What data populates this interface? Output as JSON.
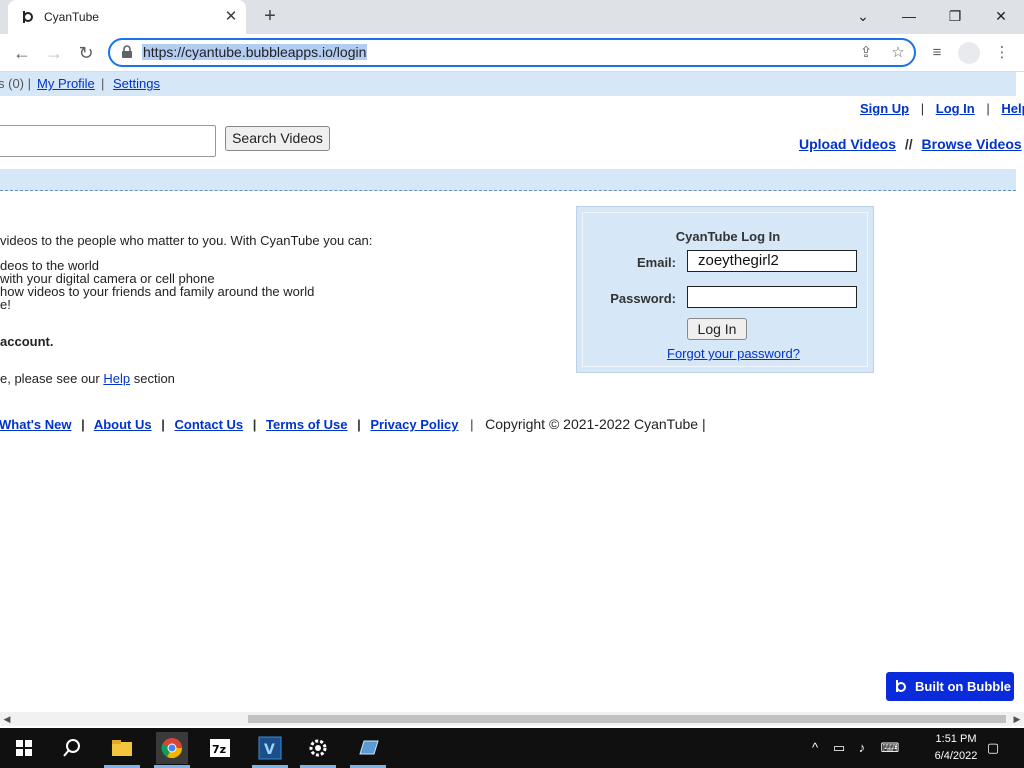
{
  "browser": {
    "tab_title": "CyanTube",
    "url": "https://cyantube.bubbleapps.io/login",
    "new_tab_symbol": "+",
    "close_tab_symbol": "✕"
  },
  "window_controls": {
    "minimize": "—",
    "restore": "❐",
    "close": "✕",
    "tab_search": "⌄"
  },
  "userbar": {
    "inbox_count": "s (0) |",
    "my_profile": "My Profile",
    "sep": "|",
    "settings": "Settings"
  },
  "top_links": {
    "sign_up": "Sign Up",
    "log_in": "Log In",
    "help": "Help",
    "sep": "|"
  },
  "search": {
    "button_label": "Search Videos",
    "value": ""
  },
  "actions": {
    "upload": "Upload Videos",
    "sep": "//",
    "browse": "Browse Videos"
  },
  "intro": {
    "line1": "videos to the people who matter to you. With CyanTube you can:",
    "bullet1": "deos to the world",
    "bullet2": " with your digital camera or cell phone",
    "bullet3": "how videos to your friends and family around the world",
    "bullet4": "e!",
    "account": "account.",
    "help_prefix": "e, please see our ",
    "help_link": "Help",
    "help_suffix": " section"
  },
  "login": {
    "title": "CyanTube Log In",
    "email_label": "Email:",
    "email_value": "zoeythegirl2",
    "password_label": "Password:",
    "password_value": "",
    "button": "Log In",
    "forgot": "Forgot your password?"
  },
  "footer": {
    "whats_new": "What's New",
    "about": "About Us",
    "contact": "Contact Us",
    "terms": "Terms of Use",
    "privacy": "Privacy Policy",
    "sep": "|",
    "copyright": "Copyright © 2021-2022 CyanTube |"
  },
  "badge": {
    "label": "Built on Bubble"
  },
  "taskbar": {
    "time": "1:51 PM",
    "date": "6/4/2022",
    "icons": [
      "windows-start",
      "search",
      "file-explorer",
      "chrome",
      "7zip",
      "vim",
      "settings",
      "virtualbox"
    ]
  },
  "colors": {
    "link": "#0033cc",
    "accent_bar": "#d6e7f7",
    "badge": "#0a2bdc",
    "omnibox_border": "#1a73e8"
  }
}
